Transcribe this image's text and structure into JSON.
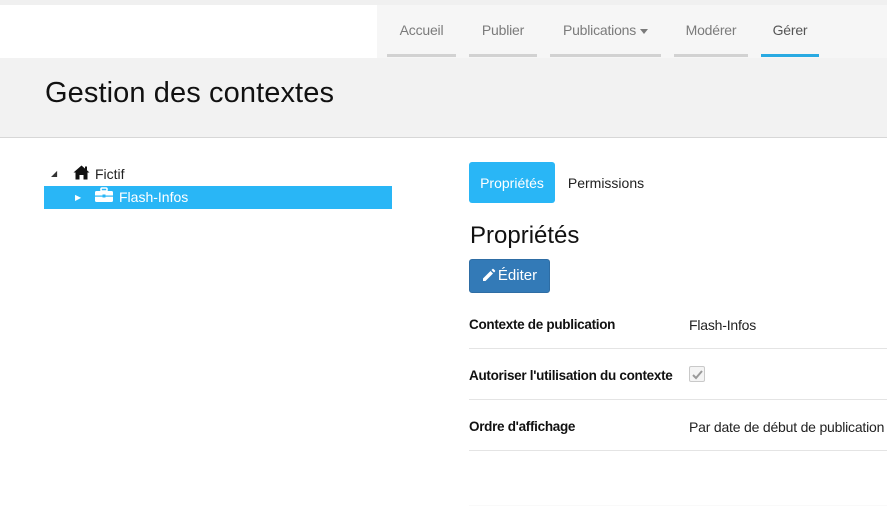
{
  "nav": {
    "items": [
      {
        "label": "Accueil"
      },
      {
        "label": "Publier"
      },
      {
        "label": "Publications"
      },
      {
        "label": "Modérer"
      },
      {
        "label": "Gérer"
      }
    ],
    "active": "Gérer",
    "accent": "#29aae2"
  },
  "header": {
    "title": "Gestion des contextes"
  },
  "tree": {
    "root": {
      "label": "Fictif",
      "icon": "home-icon",
      "expanded": true
    },
    "child": {
      "label": "Flash-Infos",
      "icon": "briefcase-icon",
      "selected": true
    }
  },
  "tabs": [
    {
      "label": "Propriétés",
      "active": true
    },
    {
      "label": "Permissions",
      "active": false
    }
  ],
  "section": {
    "title": "Propriétés",
    "edit_label": "Éditer"
  },
  "properties": [
    {
      "key": "Contexte de publication",
      "value": "Flash-Infos"
    },
    {
      "key": "Autoriser l'utilisation du contexte",
      "checked": true
    },
    {
      "key": "Ordre d'affichage",
      "value": "Par date de début de publication"
    }
  ],
  "colors": {
    "primary": "#337ab7",
    "selection": "#29b6f6"
  }
}
